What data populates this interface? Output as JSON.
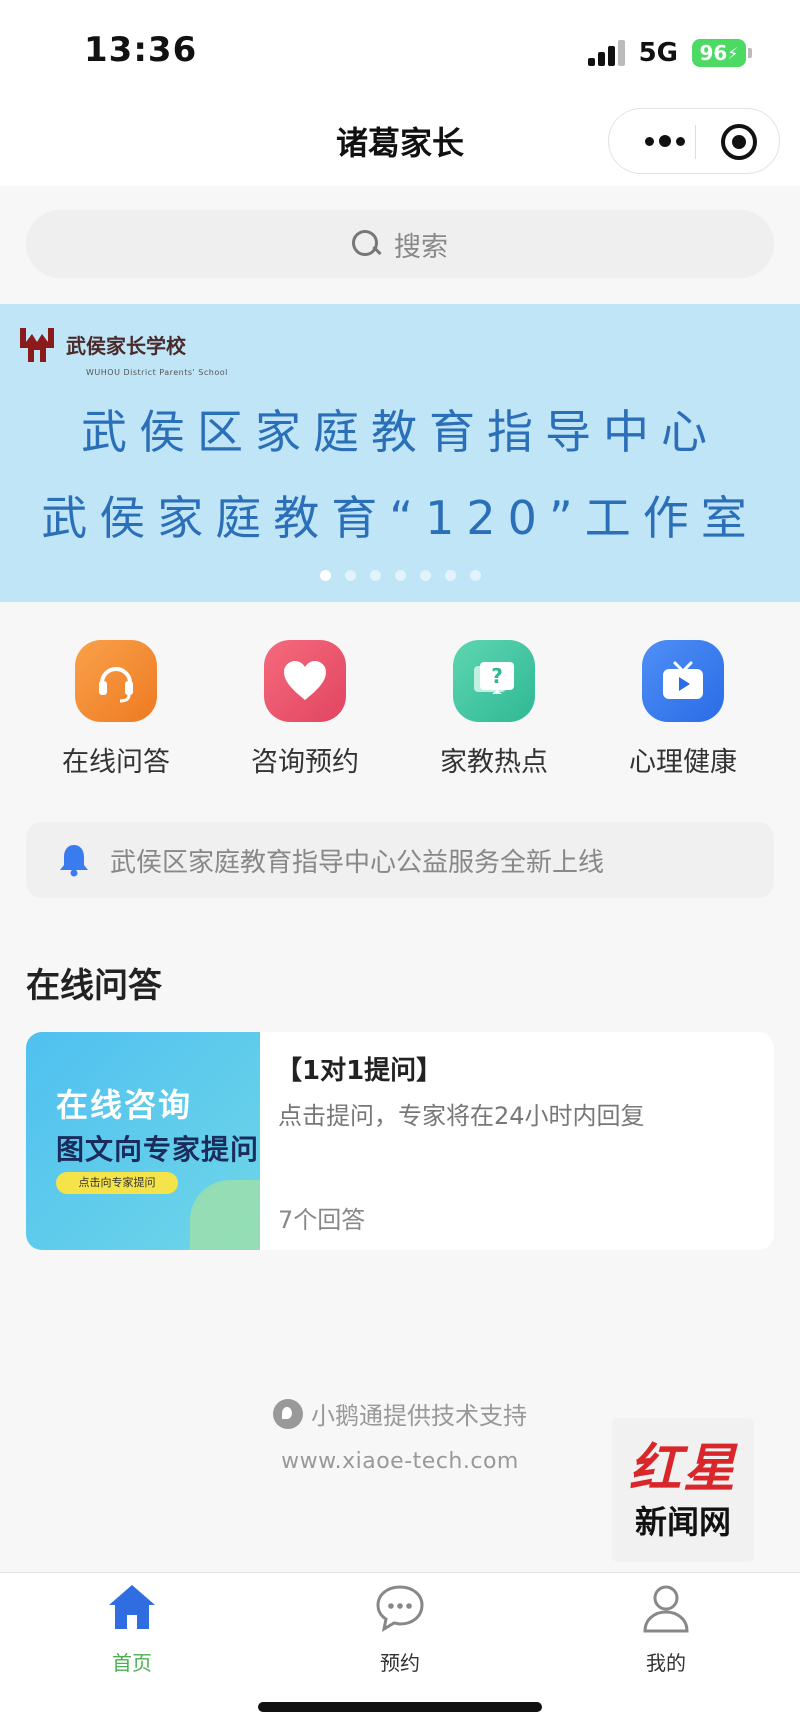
{
  "status": {
    "time": "13:36",
    "network": "5G",
    "battery": "96"
  },
  "nav": {
    "title": "诸葛家长"
  },
  "search": {
    "placeholder": "搜索"
  },
  "banner": {
    "logo_text": "武侯家长学校",
    "logo_sub": "WUHOU District Parents' School",
    "line1": "武侯区家庭教育指导中心",
    "line2": "武侯家庭教育“120”工作室",
    "slide_count": 7,
    "active_slide": 0
  },
  "menu": {
    "items": [
      {
        "label": "在线问答",
        "icon": "headset-icon",
        "color": "#f08a2e"
      },
      {
        "label": "咨询预约",
        "icon": "heart-icon",
        "color": "#e8516b"
      },
      {
        "label": "家教热点",
        "icon": "question-chat-icon",
        "color": "#3cc39d"
      },
      {
        "label": "心理健康",
        "icon": "tv-play-icon",
        "color": "#3a7cf0"
      }
    ]
  },
  "notice": {
    "text": "武侯区家庭教育指导中心公益服务全新上线"
  },
  "section": {
    "title": "在线问答"
  },
  "qa": {
    "thumb_line1": "在线咨询",
    "thumb_line2": "图文向专家提问",
    "thumb_button": "点击向专家提问",
    "title": "【1对1提问】",
    "desc": "点击提问，专家将在24小时内回复",
    "count": "7个回答"
  },
  "support": {
    "text": "小鹅通提供技术支持",
    "url": "www.xiaoe-tech.com"
  },
  "watermark": {
    "top": "红星",
    "bottom": "新闻网"
  },
  "tabbar": {
    "items": [
      {
        "label": "首页",
        "icon": "home-icon",
        "active": true
      },
      {
        "label": "预约",
        "icon": "chat-bubble-icon",
        "active": false
      },
      {
        "label": "我的",
        "icon": "person-icon",
        "active": false
      }
    ]
  },
  "colors": {
    "accent_green": "#4caf50",
    "banner_bg": "#bfe5f7",
    "banner_text": "#2b6fb8",
    "tab_blue": "#2f6de0"
  }
}
